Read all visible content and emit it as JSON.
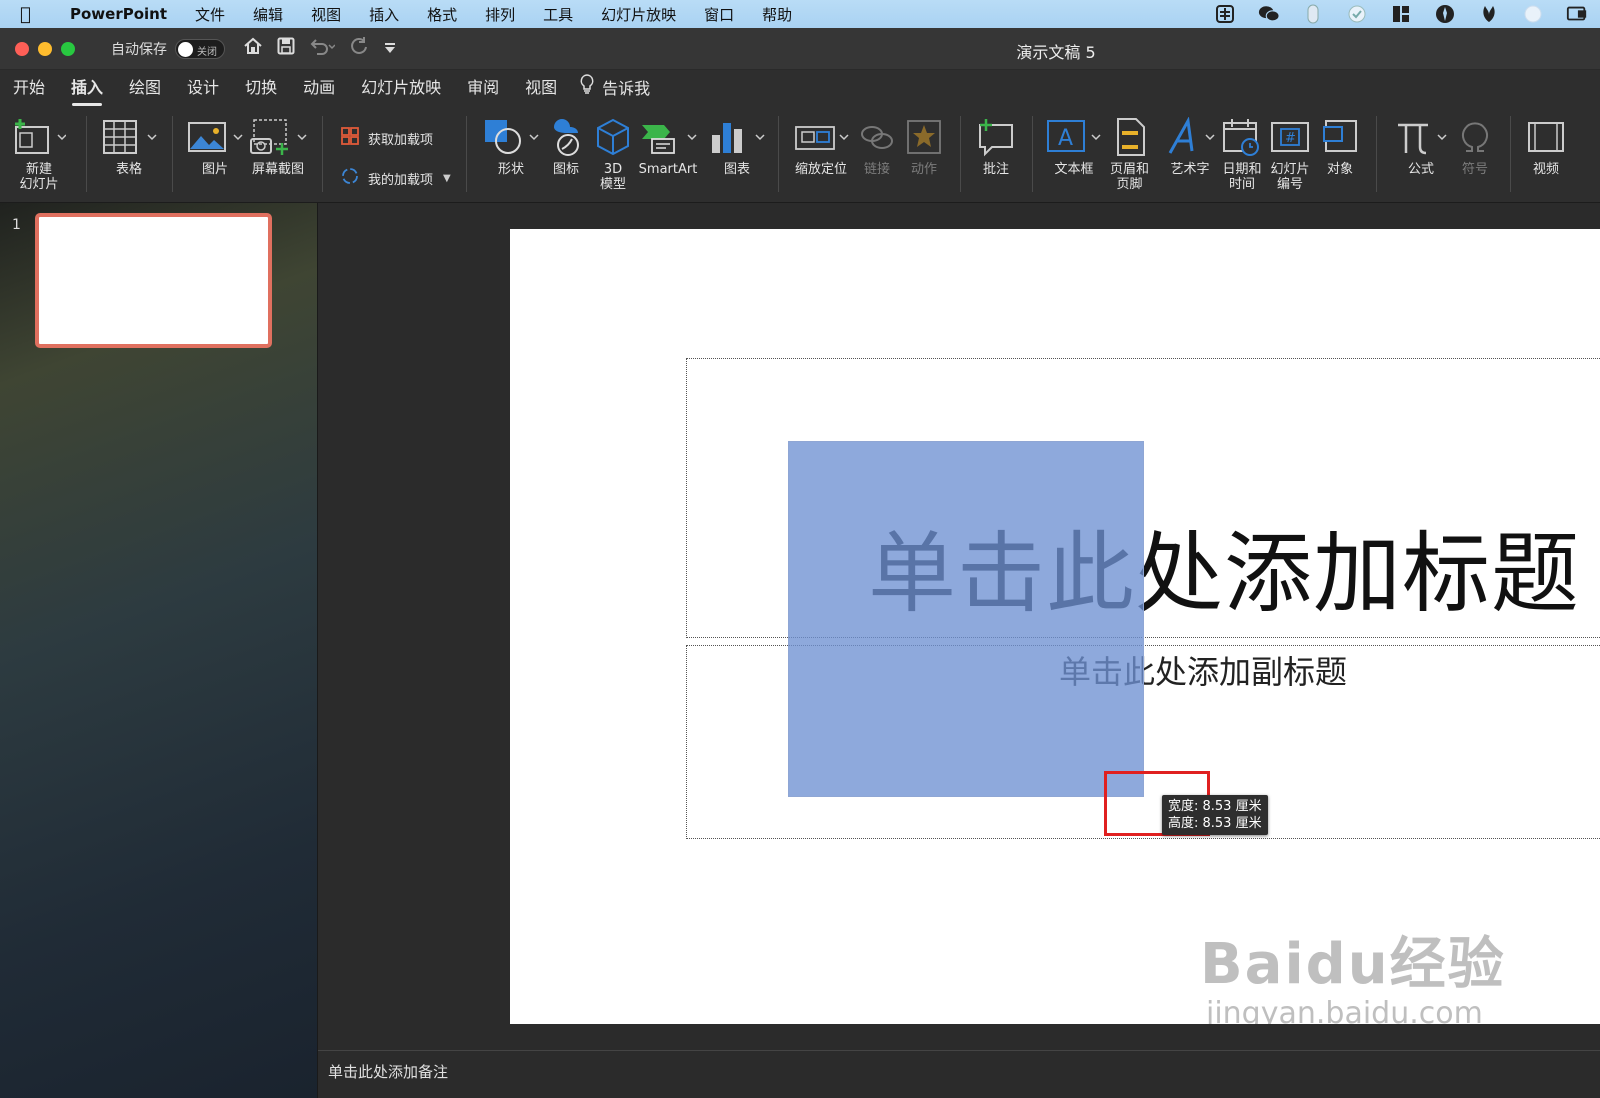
{
  "menubar": {
    "apple": "",
    "app_name": "PowerPoint",
    "items": [
      "文件",
      "编辑",
      "视图",
      "插入",
      "格式",
      "排列",
      "工具",
      "幻灯片放映",
      "窗口",
      "帮助"
    ],
    "tray_icons": [
      "input-method-icon",
      "wechat-icon",
      "mouse-icon",
      "cloud-sync-icon",
      "layout-icon",
      "app-icon",
      "leaf-icon",
      "circle-icon",
      "screen-mirror-icon"
    ]
  },
  "titlebar": {
    "autosave_label": "自动保存",
    "autosave_state": "关闭",
    "document_title": "演示文稿 5"
  },
  "tabs": [
    "开始",
    "插入",
    "绘图",
    "设计",
    "切换",
    "动画",
    "幻灯片放映",
    "审阅",
    "视图"
  ],
  "active_tab": "插入",
  "tell_me": "告诉我",
  "ribbon": {
    "new_slide": "新建\n幻灯片",
    "table": "表格",
    "picture": "图片",
    "screenshot": "屏幕截图",
    "get_addins": "获取加载项",
    "my_addins": "我的加载项",
    "shapes": "形状",
    "icons": "图标",
    "model_3d": "3D\n模型",
    "smartart": "SmartArt",
    "chart": "图表",
    "zoom": "缩放定位",
    "link": "链接",
    "action": "动作",
    "comment": "批注",
    "textbox": "文本框",
    "header_footer": "页眉和\n页脚",
    "wordart": "艺术字",
    "datetime": "日期和\n时间",
    "slide_number": "幻灯片\n编号",
    "object": "对象",
    "equation": "公式",
    "symbol": "符号",
    "video": "视频"
  },
  "slides_panel": {
    "slide_number": "1"
  },
  "slide": {
    "title_placeholder": "单击此处添加标题",
    "subtitle_placeholder": "单击此处添加副标题",
    "size_tooltip": {
      "width": "宽度: 8.53 厘米",
      "height": "高度: 8.53 厘米"
    }
  },
  "watermark": {
    "logo": "Baidu经验",
    "url": "jingyan.baidu.com"
  },
  "notes": {
    "placeholder": "单击此处添加备注"
  },
  "colors": {
    "shape_fill": "#8fa9dc",
    "thumb_border": "#e0705f",
    "highlight": "#e02020"
  }
}
